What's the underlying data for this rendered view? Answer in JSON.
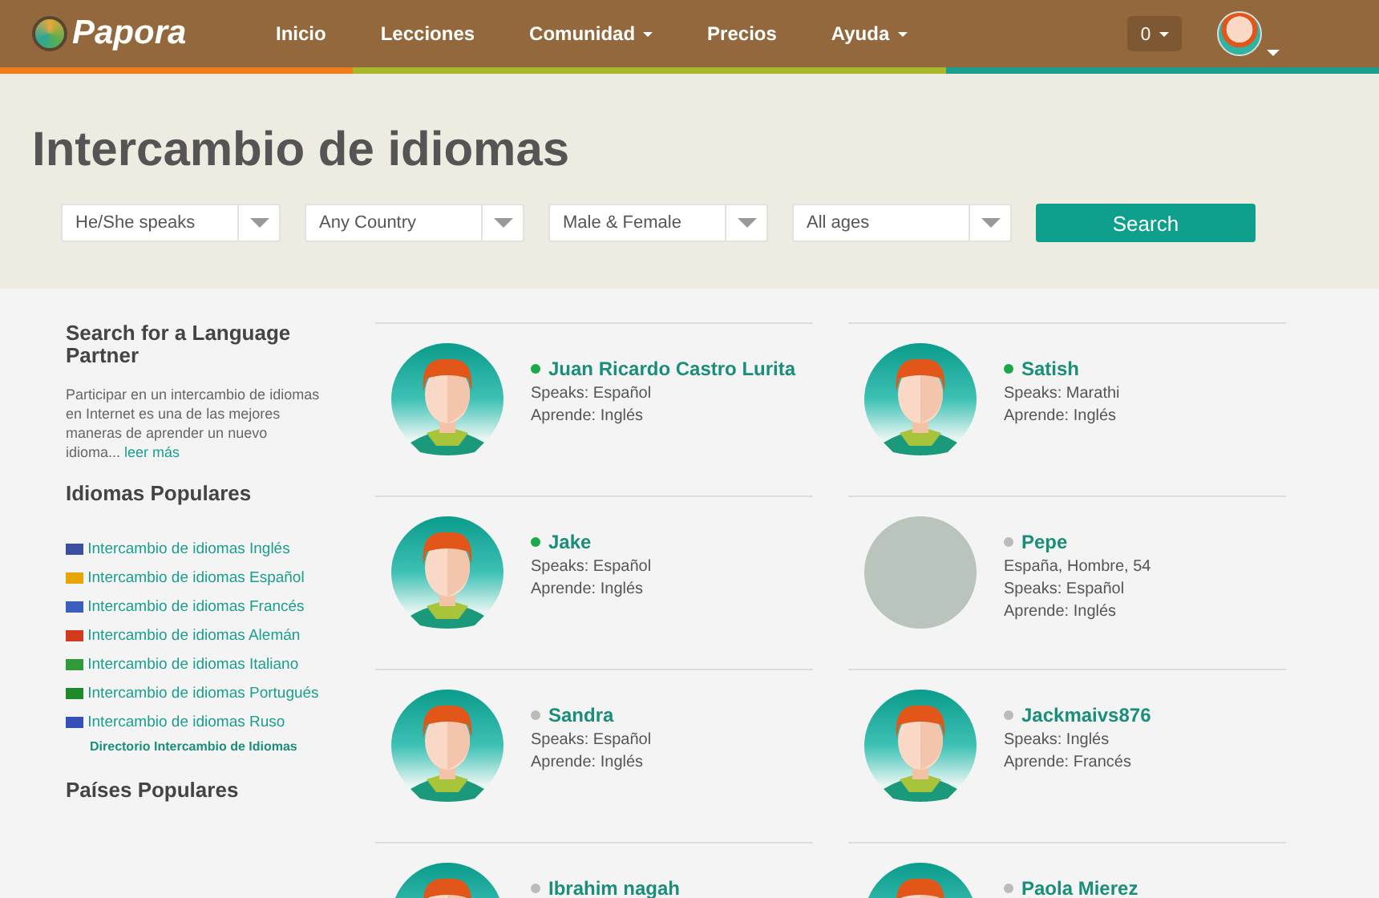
{
  "nav": {
    "brand": "Papora",
    "items": [
      {
        "label": "Inicio",
        "dropdown": false
      },
      {
        "label": "Lecciones",
        "dropdown": false
      },
      {
        "label": "Comunidad",
        "dropdown": true
      },
      {
        "label": "Precios",
        "dropdown": false
      },
      {
        "label": "Ayuda",
        "dropdown": true
      }
    ],
    "counter": "0"
  },
  "header": {
    "title": "Intercambio de idiomas",
    "filters": [
      {
        "value": "He/She speaks"
      },
      {
        "value": "Any Country"
      },
      {
        "value": "Male & Female"
      },
      {
        "value": "All ages"
      }
    ],
    "search_button": "Search"
  },
  "sidebar": {
    "heading": "Search for a Language Partner",
    "description": "Participar en un intercambio de idiomas en Internet es una de las mejores maneras de aprender un nuevo idioma...",
    "read_more": "leer más",
    "popular_heading": "Idiomas Populares",
    "links": [
      {
        "label": "Intercambio de idiomas Inglés",
        "color": "#3b4fa0"
      },
      {
        "label": "Intercambio de idiomas Español",
        "color": "#e8a400"
      },
      {
        "label": "Intercambio de idiomas Francés",
        "color": "#3b5fc0"
      },
      {
        "label": "Intercambio de idiomas Alemán",
        "color": "#d23a1e"
      },
      {
        "label": "Intercambio de idiomas Italiano",
        "color": "#2e9a3a"
      },
      {
        "label": "Intercambio de idiomas Portugués",
        "color": "#1f8a2a"
      },
      {
        "label": "Intercambio de idiomas Ruso",
        "color": "#3550b8"
      }
    ],
    "directory": "Directorio Intercambio de Idiomas",
    "countries_heading": "Países Populares"
  },
  "partners": [
    {
      "name": "Juan Ricardo Castro Lurita",
      "online": true,
      "kind": "avatar",
      "lines": [
        "Speaks: Español",
        "Aprende: Inglés"
      ]
    },
    {
      "name": "Satish",
      "online": true,
      "kind": "avatar",
      "lines": [
        "Speaks: Marathi",
        "Aprende: Inglés"
      ]
    },
    {
      "name": "Jake",
      "online": true,
      "kind": "avatar",
      "lines": [
        "Speaks: Español",
        "Aprende: Inglés"
      ]
    },
    {
      "name": "Pepe",
      "online": false,
      "kind": "photo",
      "lines": [
        "España, Hombre, 54",
        "Speaks: Español",
        "Aprende: Inglés"
      ]
    },
    {
      "name": "Sandra",
      "online": false,
      "kind": "avatar",
      "lines": [
        "Speaks: Español",
        "Aprende: Inglés"
      ]
    },
    {
      "name": "Jackmaivs876",
      "online": false,
      "kind": "avatar",
      "lines": [
        "Speaks: Inglés",
        "Aprende: Francés"
      ]
    },
    {
      "name": "Ibrahim nagah",
      "online": false,
      "kind": "avatar"
    },
    {
      "name": "Paola Mierez",
      "online": false,
      "kind": "avatar"
    }
  ]
}
